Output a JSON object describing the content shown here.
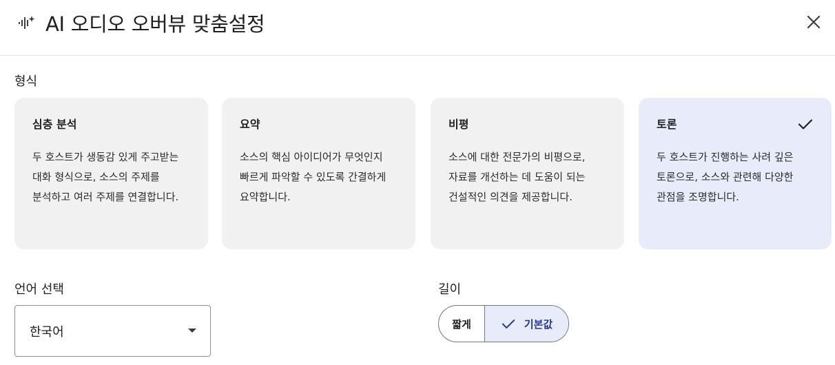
{
  "dialog": {
    "title": "AI 오디오 오버뷰 맞춤설정",
    "title_icon": "audio-sparkle-icon",
    "close_icon": "close-icon"
  },
  "format": {
    "label": "형식",
    "cards": [
      {
        "title": "심층 분석",
        "description": "두 호스트가 생동감 있게 주고받는 대화 형식으로, 소스의 주제를 분석하고 여러 주제를 연결합니다.",
        "selected": false
      },
      {
        "title": "요약",
        "description": "소스의 핵심 아이디어가 무엇인지 빠르게 파악할 수 있도록 간결하게 요약합니다.",
        "selected": false
      },
      {
        "title": "비평",
        "description": "소스에 대한 전문가의 비평으로, 자료를 개선하는 데 도움이 되는 건설적인 의견을 제공합니다.",
        "selected": false
      },
      {
        "title": "토론",
        "description": "두 호스트가 진행하는 사려 깊은 토론으로, 소스와 관련해 다양한 관점을 조명합니다.",
        "selected": true
      }
    ]
  },
  "language": {
    "label": "언어 선택",
    "selected": "한국어"
  },
  "length": {
    "label": "길이",
    "options": [
      "짧게",
      "기본값"
    ],
    "selected": "기본값"
  },
  "colors": {
    "selected_bg": "#e8ebf9",
    "card_bg": "#f1f1f1",
    "selected_text": "#233a8c",
    "accent": "#1a73e8"
  }
}
